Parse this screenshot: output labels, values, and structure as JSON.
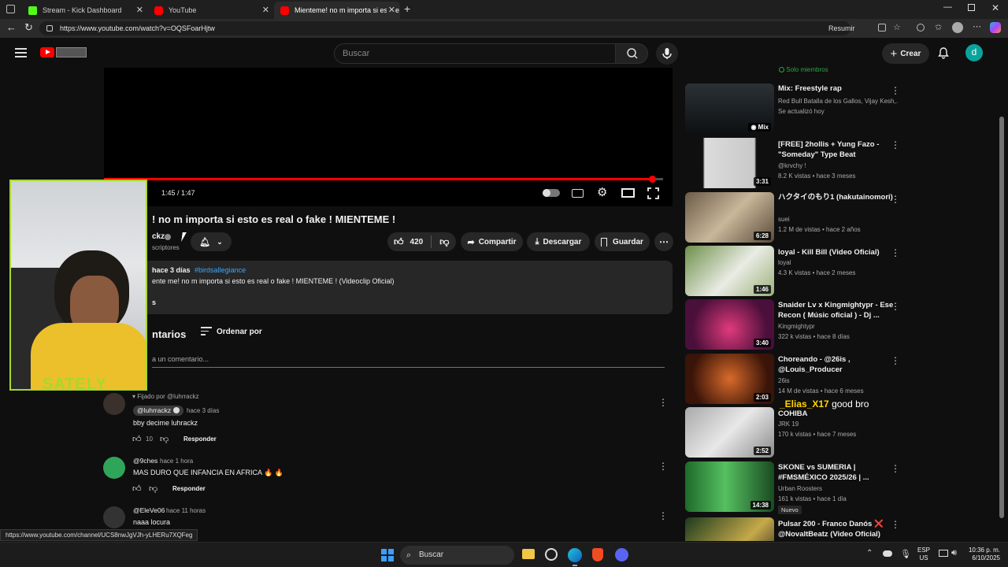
{
  "browser": {
    "tabs": [
      {
        "label": "Stream - Kick Dashboard"
      },
      {
        "label": "YouTube"
      },
      {
        "label": "Mienteme! no m importa si esto e"
      }
    ],
    "url": "https://www.youtube.com/watch?v=OQSFoarHjtw",
    "resumir": "Resumir",
    "status_url": "https://www.youtube.com/channel/UCS8nwJgVJh-yLHERu7XQFeg"
  },
  "header": {
    "search_placeholder": "Buscar",
    "create_label": "Crear",
    "avatar_letter": "d"
  },
  "player": {
    "time": "1:45 / 1:47",
    "progress": 0.98
  },
  "video": {
    "title": "! no m importa si esto es real o fake ! MIENTEME !",
    "channel": "ckz",
    "subs": "scriptores",
    "likes": "420",
    "share": "Compartir",
    "download": "Descargar",
    "save": "Guardar",
    "desc_meta": "hace 3 días",
    "desc_tag": "#birdsallegiance",
    "desc_text": "ente me! no m importa si esto es real o fake ! MIENTEME ! (Videoclip Oficial)",
    "desc_more": "s"
  },
  "comments": {
    "header": "ntarios",
    "sort": "Ordenar por",
    "add_placeholder": "a un comentario...",
    "reply": "Responder",
    "items": [
      {
        "pinned": "Fijado por @luhrrackz",
        "author": "@luhrrackz",
        "time": "hace 3 días",
        "text": "bby decime luhrackz",
        "likes": "10"
      },
      {
        "author": "@9ches",
        "time": "hace 1 hora",
        "text": "MAS DURO QUE INFANCIA EN AFRICA 🔥 🔥",
        "likes": ""
      },
      {
        "author": "@EleVe06",
        "time": "hace 11 horas",
        "text": "naaa locura",
        "likes": ""
      }
    ]
  },
  "sidebar": {
    "members_badge": "Solo miembros",
    "videos": [
      {
        "title": "Mix: Freestyle rap",
        "l1": "Red Bull Batalla de los Gallos, Vijay Kesh,...",
        "l2": "Se actualizó hoy",
        "dur": "Mix"
      },
      {
        "title": "[FREE] 2hollis + Yung Fazo - \"Someday\" Type Beat",
        "l1": "@krvchy !",
        "l2": "8.2 K vistas • hace 3 meses",
        "dur": "3:31"
      },
      {
        "title": "ハクタイのもり1 (hakutainomori)",
        "l1": "suei",
        "l2": "1.2 M de vistas • hace 2 años",
        "dur": "6:28"
      },
      {
        "title": "loyal - Kill Bill (Video Oficial)",
        "l1": "loyal",
        "l2": "4.3 K vistas • hace 2 meses",
        "dur": "1:46"
      },
      {
        "title": "Snaider Lv x Kingmightypr - Ese Recon ( Músic oficial ) - Dj ...",
        "l1": "Kingmightypr",
        "l2": "322 k vistas • hace 8 días",
        "dur": "3:40"
      },
      {
        "title": "Choreando - @26is , @Louis_Producer",
        "l1": "26is",
        "l2": "14 M de vistas • hace 6 meses",
        "dur": "2:03"
      },
      {
        "title": "COHIBA",
        "l1": "JRK 19",
        "l2": "170 k vistas • hace 7 meses",
        "dur": "2:52"
      },
      {
        "title": "SKONE vs SUMERIA | #FMSMÉXICO 2025/26 | ...",
        "l1": "Urban Roosters",
        "l2": "161 k vistas • hace 1 día",
        "dur": "14:38",
        "badge": "Nuevo"
      },
      {
        "title": "Pulsar 200 - Franco Danós ❌ @NovaltBeatz (Video Oficial)",
        "l1": "",
        "l2": "",
        "dur": ""
      }
    ]
  },
  "overlay": {
    "chat_user": "_Elias_X17",
    "chat_msg": "good bro",
    "webcam_text": "SATELY"
  },
  "taskbar": {
    "search": "Buscar",
    "lang1": "ESP",
    "lang2": "US",
    "time": "10:36 p. m.",
    "date": "6/10/2025"
  }
}
